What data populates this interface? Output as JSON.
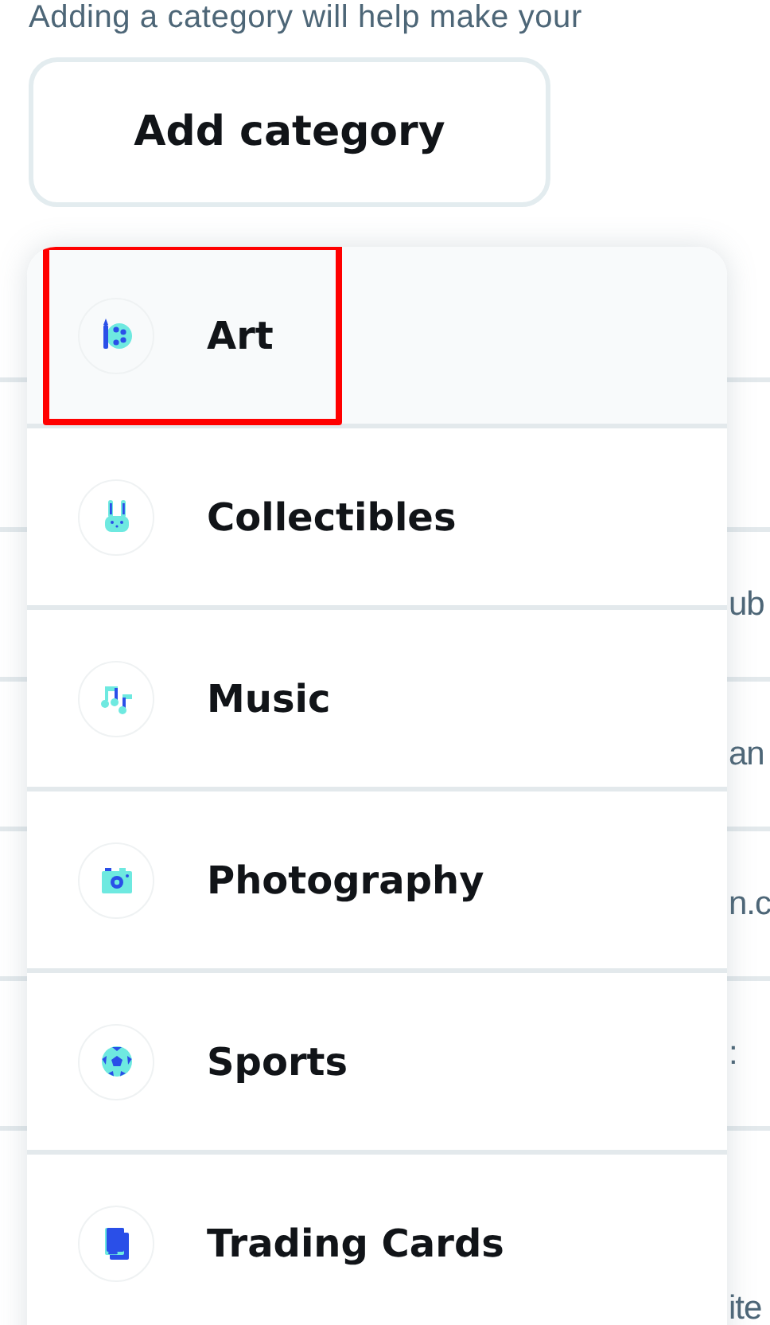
{
  "intro_text": "Adding a category will help make your",
  "add_category_button": {
    "label": "Add category"
  },
  "background_fragments": [
    "ub",
    "an",
    "n.c",
    ":",
    "ite"
  ],
  "category_menu": {
    "items": [
      {
        "label": "Art",
        "selected": true,
        "marked": true
      },
      {
        "label": "Collectibles",
        "selected": false,
        "marked": false
      },
      {
        "label": "Music",
        "selected": false,
        "marked": false
      },
      {
        "label": "Photography",
        "selected": false,
        "marked": false
      },
      {
        "label": "Sports",
        "selected": false,
        "marked": false
      },
      {
        "label": "Trading Cards",
        "selected": false,
        "marked": false
      }
    ]
  }
}
